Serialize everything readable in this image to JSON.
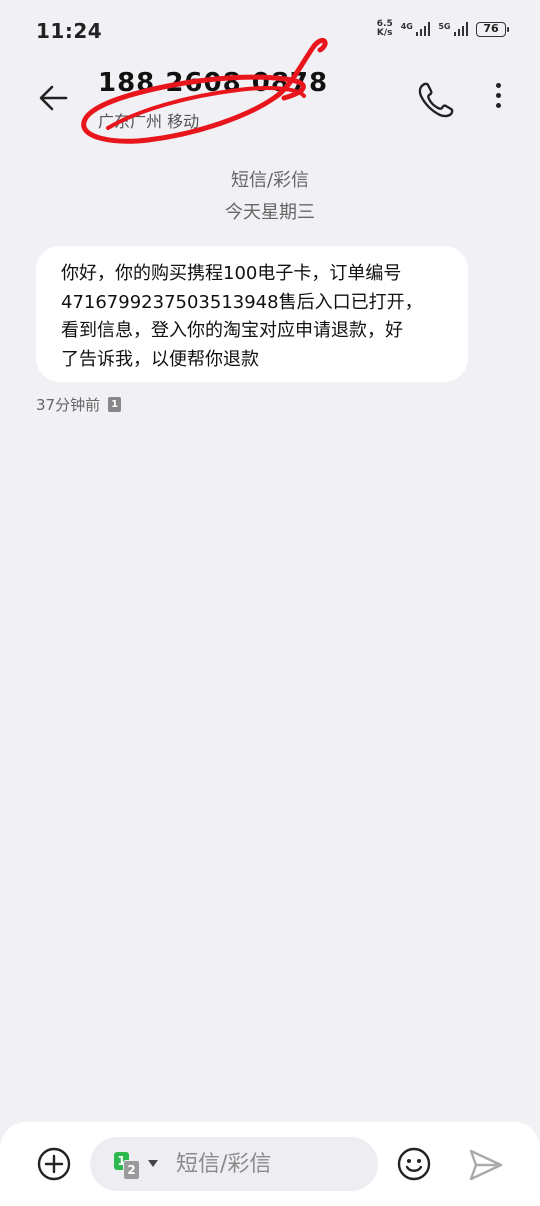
{
  "status_bar": {
    "time": "11:24",
    "net_speed_value": "6.5",
    "net_speed_unit": "K/s",
    "sim1_label": "4G",
    "sim2_label": "5G",
    "battery": "76"
  },
  "header": {
    "number": "188 2608 0878",
    "location": "广东广州 移动"
  },
  "thread": {
    "type_label": "短信/彩信",
    "date_label": "今天星期三"
  },
  "message": {
    "lines": [
      "你好，你的购买携程100电子卡，订单编号",
      "4716799237503513948售后入口已打开，",
      "看到信息，登入你的淘宝对应申请退款，好",
      "了告诉我，以便帮你退款"
    ],
    "time": "37分钟前",
    "sim_badge": "1"
  },
  "composer": {
    "placeholder": "短信/彩信",
    "sim_primary": "1",
    "sim_secondary": "2"
  },
  "icons": [
    "back-arrow-icon",
    "phone-icon",
    "more-vertical-icon",
    "add-circle-icon",
    "emoji-icon",
    "send-icon"
  ],
  "colors": {
    "background": "#f1f1f5",
    "bubble": "#ffffff",
    "sim_active": "#2db84d",
    "annotation": "#e8161c"
  }
}
